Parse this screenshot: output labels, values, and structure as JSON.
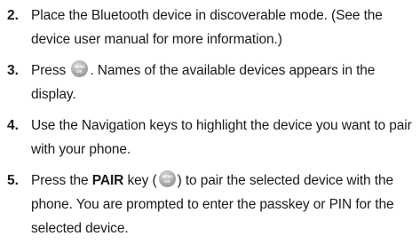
{
  "steps": [
    {
      "number": "2.",
      "text": "Place the Bluetooth device in discoverable mode. (See the device user manual for more information.)"
    },
    {
      "number": "3.",
      "text_before": "Press ",
      "text_after": ". Names of the available devices appears in the display."
    },
    {
      "number": "4.",
      "text": "Use the Navigation keys to highlight the device you want to pair with your phone."
    },
    {
      "number": "5.",
      "text_before": "Press the ",
      "key_label": "PAIR",
      "text_mid": " key (",
      "text_after": ") to pair the selected device with the phone. You are prompted to enter the passkey or PIN for the selected device."
    }
  ],
  "icons": {
    "menu_ok_key": "menu-ok-key-icon",
    "icon_top_text": "MENU",
    "icon_bottom_text": "OK"
  }
}
